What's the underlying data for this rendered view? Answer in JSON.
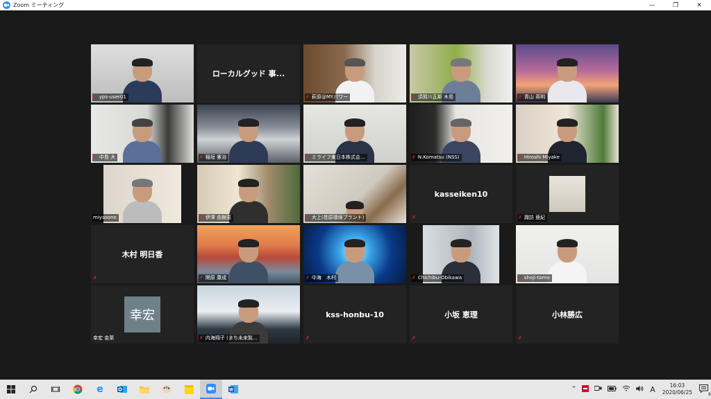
{
  "window": {
    "title": "Zoom ミーティング",
    "controls": [
      "—",
      "❐",
      "✕"
    ]
  },
  "tiles": [
    {
      "name": "yps-user01",
      "type": "video"
    },
    {
      "name": "ローカルグッド 事...",
      "type": "name_only"
    },
    {
      "name": "萩原@MYパワー",
      "type": "video"
    },
    {
      "name": "須賀川瓦斯 木島",
      "type": "video"
    },
    {
      "name": "青山 英明",
      "type": "video",
      "active": true
    },
    {
      "name": "中島 大",
      "type": "video"
    },
    {
      "name": "稲垣 憲治",
      "type": "video"
    },
    {
      "name": "ミライフ東日本株式会...",
      "type": "video"
    },
    {
      "name": "N.Komatsu (NSS)",
      "type": "video"
    },
    {
      "name": "Hiroshi Miyake",
      "type": "video"
    },
    {
      "name": "miyasone",
      "type": "video"
    },
    {
      "name": "伊澤 由樹恵",
      "type": "video"
    },
    {
      "name": "大上(荏原環境プラント)",
      "type": "video"
    },
    {
      "name": "kasseiken10",
      "type": "name_only"
    },
    {
      "name": "諏訪 亜紀",
      "type": "photo"
    },
    {
      "name": "木村 明日香",
      "type": "name_only"
    },
    {
      "name": "関原 康成",
      "type": "video"
    },
    {
      "name": "中海　木村",
      "type": "video"
    },
    {
      "name": "Chichibu-Obikawa",
      "type": "video"
    },
    {
      "name": "shoji-tomo",
      "type": "video"
    },
    {
      "name": "幸宏 金栗",
      "type": "avatar",
      "avatar_text": "幸宏"
    },
    {
      "name": "内海翔子 (まち未来製...",
      "type": "video"
    },
    {
      "name": "kss-honbu-10",
      "type": "name_only"
    },
    {
      "name": "小坂 恵理",
      "type": "name_only"
    },
    {
      "name": "小林勝広",
      "type": "name_only"
    }
  ],
  "taskbar": {
    "time": "16:03",
    "date": "2020/06/25",
    "ime": "A",
    "notification_count": "8"
  },
  "colors": {
    "active_border": "#d6e15a",
    "muted_mic": "#e0281b",
    "zoom_blue": "#2d8cff"
  }
}
